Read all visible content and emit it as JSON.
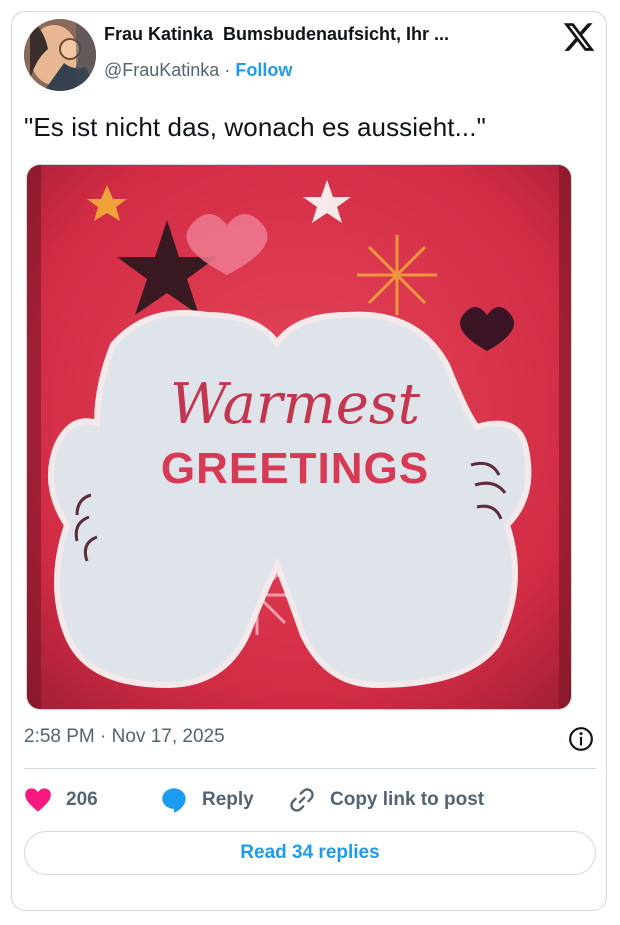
{
  "author": {
    "name": "Frau Katinka 󠀠 Bumsbudenaufsicht, Ihr ...",
    "handle": "@FrauKatinka",
    "separator": "·",
    "follow_label": "Follow"
  },
  "tweet": {
    "text": "\"Es ist nicht das, wonach es aussieht...\"",
    "image_text": {
      "script_word": "Warmest",
      "block_word": "GREETINGS"
    },
    "timestamp": "2:58 PM · Nov 17, 2025"
  },
  "actions": {
    "like_count": "206",
    "reply_label": "Reply",
    "copy_label": "Copy link to post"
  },
  "read_replies_label": "Read 34 replies",
  "colors": {
    "accent": "#1d9bf0",
    "like": "#f91880",
    "muted_text": "#536471",
    "border": "#cfd9de",
    "image_red": "#d8334a"
  },
  "icons": [
    "x-logo-icon",
    "info-icon",
    "heart-icon",
    "reply-bubble-icon",
    "link-icon"
  ]
}
